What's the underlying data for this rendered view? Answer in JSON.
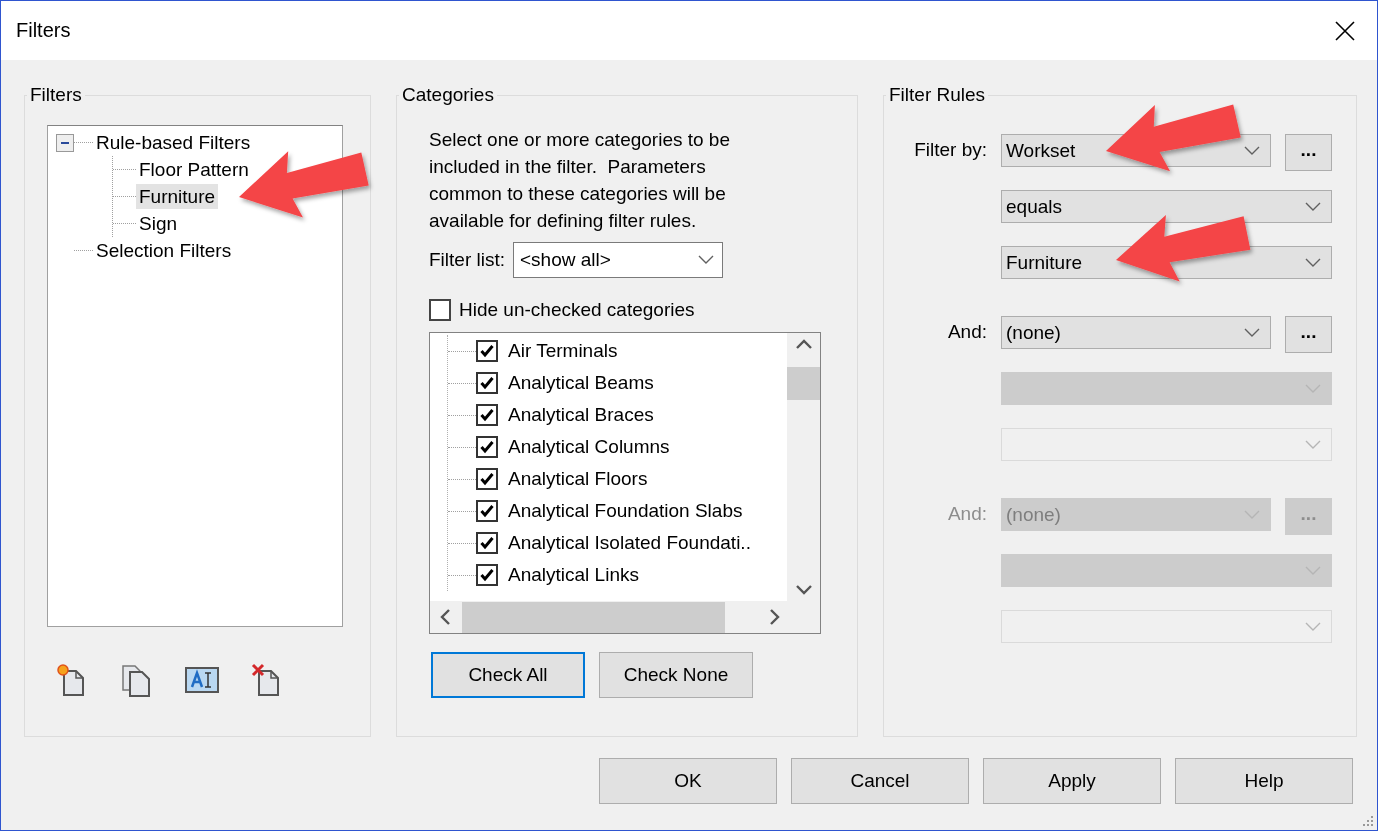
{
  "window": {
    "title": "Filters"
  },
  "filters_panel": {
    "title": "Filters",
    "tree": [
      {
        "label": "Rule-based Filters",
        "expanded": true,
        "selected": false,
        "children": [
          {
            "label": "Floor Pattern",
            "selected": false
          },
          {
            "label": "Furniture",
            "selected": true
          },
          {
            "label": "Sign",
            "selected": false
          }
        ]
      },
      {
        "label": "Selection Filters",
        "selected": false
      }
    ]
  },
  "categories_panel": {
    "title": "Categories",
    "description": "Select one or more categories to be\nincluded in the filter.  Parameters\ncommon to these categories will be\navailable for defining filter rules.",
    "filter_list": {
      "label": "Filter list:",
      "value": "<show all>"
    },
    "hide_unchecked": {
      "label": "Hide un-checked categories",
      "checked": false
    },
    "items": [
      {
        "label": "Air Terminals",
        "checked": true
      },
      {
        "label": "Analytical Beams",
        "checked": true
      },
      {
        "label": "Analytical Braces",
        "checked": true
      },
      {
        "label": "Analytical Columns",
        "checked": true
      },
      {
        "label": "Analytical Floors",
        "checked": true
      },
      {
        "label": "Analytical Foundation Slabs",
        "checked": true
      },
      {
        "label": "Analytical Isolated Foundati..",
        "checked": true
      },
      {
        "label": "Analytical Links",
        "checked": true
      }
    ],
    "buttons": [
      {
        "label": "Check All",
        "focused": true
      },
      {
        "label": "Check None",
        "focused": false
      }
    ]
  },
  "filter_rules_panel": {
    "title": "Filter Rules",
    "groups": [
      {
        "label": "Filter by:",
        "disabled": false,
        "browse_button": "...",
        "fields": [
          {
            "kind": "dropdown",
            "value": "Workset",
            "disabled": false
          },
          {
            "kind": "dropdown",
            "value": "equals",
            "disabled": false
          },
          {
            "kind": "dropdown",
            "value": "Furniture",
            "disabled": false
          }
        ]
      },
      {
        "label": "And:",
        "disabled": false,
        "browse_button": "...",
        "fields": [
          {
            "kind": "dropdown",
            "value": "(none)",
            "disabled": false
          },
          {
            "kind": "dropdown",
            "disabled": true
          },
          {
            "kind": "editable",
            "disabled": true
          }
        ]
      },
      {
        "label": "And:",
        "disabled": true,
        "browse_button": "...",
        "fields": [
          {
            "kind": "dropdown",
            "value": "(none)",
            "disabled": true
          },
          {
            "kind": "dropdown",
            "disabled": true
          },
          {
            "kind": "editable",
            "disabled": true
          }
        ]
      }
    ]
  },
  "buttons": [
    "OK",
    "Cancel",
    "Apply",
    "Help"
  ]
}
